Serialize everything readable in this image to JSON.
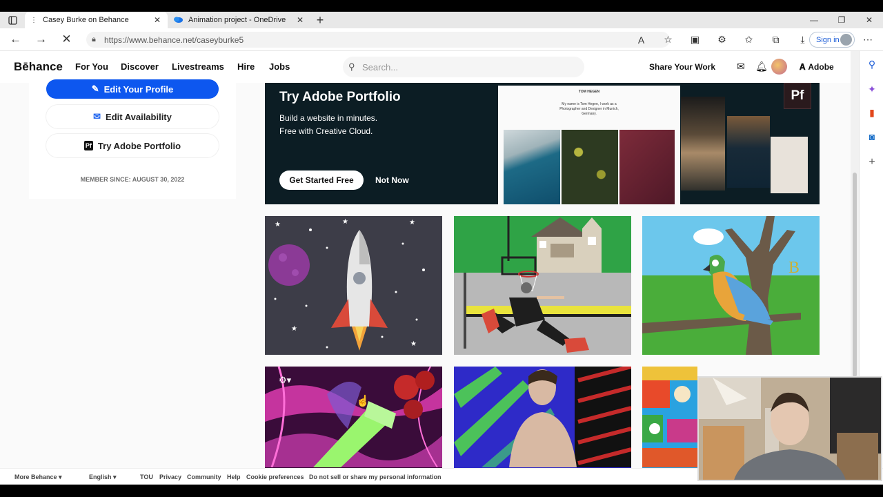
{
  "browser": {
    "tabs": [
      {
        "label": "Casey Burke on Behance",
        "active": true
      },
      {
        "label": "Animation project - OneDrive",
        "active": false
      }
    ],
    "url": "https://www.behance.net/caseyburke5",
    "signin_label": "Sign in"
  },
  "behance": {
    "logo": "Bēhance",
    "nav": [
      "For You",
      "Discover",
      "Livestreams",
      "Hire",
      "Jobs"
    ],
    "search_placeholder": "Search...",
    "share_your_work": "Share Your Work",
    "adobe_label": "Adobe"
  },
  "profile": {
    "edit_profile": "Edit Your Profile",
    "edit_availability": "Edit Availability",
    "try_portfolio": "Try Adobe Portfolio",
    "member_since": "MEMBER SINCE: AUGUST 30, 2022"
  },
  "banner": {
    "title": "Try Adobe Portfolio",
    "line1": "Build a website in minutes.",
    "line2": "Free with Creative Cloud.",
    "cta": "Get Started Free",
    "dismiss": "Not Now",
    "badge": "Pf",
    "mock_title": "TOM HEGEN",
    "mock_text": "My name is Tom Hegen, I work as a Photographer and Designer in Munich, Germany."
  },
  "projects": [
    {
      "name": "rocket-space-illustration"
    },
    {
      "name": "basketball-dunk-illustration"
    },
    {
      "name": "parrot-tree-illustration",
      "letter": "B"
    },
    {
      "name": "pink-abstract-collage"
    },
    {
      "name": "portrait-blue-background"
    },
    {
      "name": "colorful-collage"
    }
  ],
  "footer": {
    "more_behance": "More Behance ▾",
    "language": "English ▾",
    "links": [
      "TOU",
      "Privacy",
      "Community",
      "Help",
      "Cookie preferences",
      "Do not sell or share my personal information"
    ]
  },
  "colors": {
    "behance_blue": "#0d57ef",
    "banner_bg": "#0c1d24"
  }
}
